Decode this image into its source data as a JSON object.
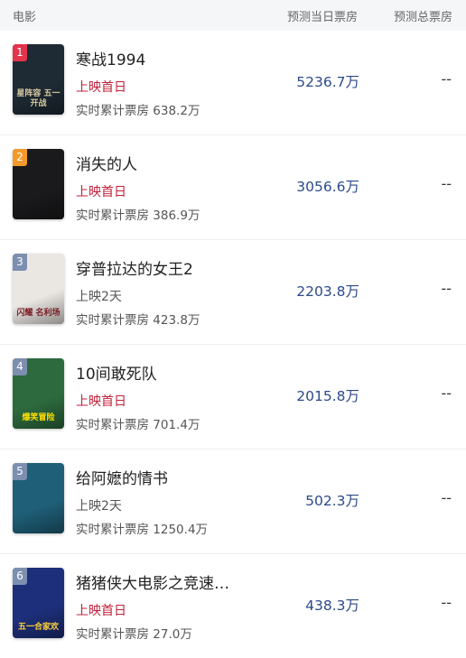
{
  "header": {
    "movie_label": "电影",
    "today_label": "预测当日票房",
    "total_label": "预测总票房"
  },
  "colors": {
    "status_first_day": "#c0213a",
    "status_other": "#555555",
    "today_value": "#2b4a8a"
  },
  "movies": [
    {
      "rank": "1",
      "title": "寒战1994",
      "status": "上映首日",
      "status_type": "first_day",
      "cumulative": "实时累计票房 638.2万",
      "today": "5236.7万",
      "total": "--",
      "poster_text": "星阵容 五一开战",
      "poster_bg": "#1e2a34",
      "poster_fg": "#d8c8a0",
      "rank_color": "#e2344c"
    },
    {
      "rank": "2",
      "title": "消失的人",
      "status": "上映首日",
      "status_type": "first_day",
      "cumulative": "实时累计票房 386.9万",
      "today": "3056.6万",
      "total": "--",
      "poster_text": "",
      "poster_bg": "#1a1a1c",
      "poster_fg": "#cccccc",
      "rank_color": "#f39a2b"
    },
    {
      "rank": "3",
      "title": "穿普拉达的女王2",
      "status": "上映2天",
      "status_type": "other",
      "cumulative": "实时累计票房 423.8万",
      "today": "2203.8万",
      "total": "--",
      "poster_text": "闪耀 名利场",
      "poster_bg": "#eae6e2",
      "poster_fg": "#7a1d24",
      "rank_color": "#7d8fb0"
    },
    {
      "rank": "4",
      "title": "10间敢死队",
      "status": "上映首日",
      "status_type": "first_day",
      "cumulative": "实时累计票房 701.4万",
      "today": "2015.8万",
      "total": "--",
      "poster_text": "爆笑冒险",
      "poster_bg": "#2d6a3e",
      "poster_fg": "#ffe000",
      "rank_color": "#7d8fb0"
    },
    {
      "rank": "5",
      "title": "给阿嬷的情书",
      "status": "上映2天",
      "status_type": "other",
      "cumulative": "实时累计票房 1250.4万",
      "today": "502.3万",
      "total": "--",
      "poster_text": "",
      "poster_bg": "#1f5f78",
      "poster_fg": "#ffffff",
      "rank_color": "#7d8fb0"
    },
    {
      "rank": "6",
      "title": "猪猪侠大电影之竞速…",
      "status": "上映首日",
      "status_type": "first_day",
      "cumulative": "实时累计票房 27.0万",
      "today": "438.3万",
      "total": "--",
      "poster_text": "五一合家欢",
      "poster_bg": "#1d2f7a",
      "poster_fg": "#ffd23a",
      "rank_color": "#7d8fb0"
    }
  ]
}
